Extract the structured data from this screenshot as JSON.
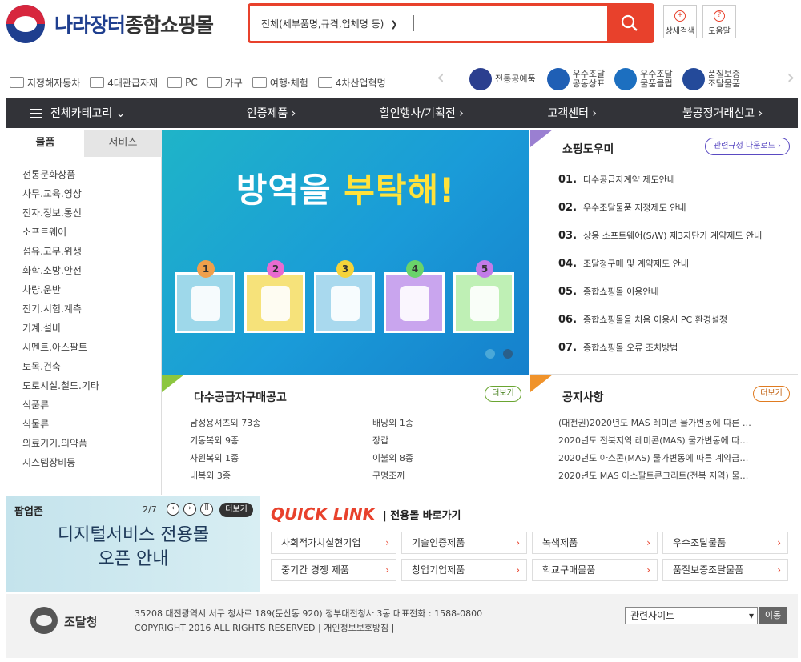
{
  "header": {
    "logo_text_1": "나라장터",
    "logo_text_2": "종합쇼핑몰",
    "search_select": "전체(세부품명,규격,업체명 등)",
    "search_placeholder": "",
    "detail_search": "상세검색",
    "help": "도움말"
  },
  "quick_menu": [
    "지정해자동차",
    "4대관급자재",
    "PC",
    "가구",
    "여행·체험",
    "4차산업혁명"
  ],
  "brands": [
    {
      "label": "전통공예품",
      "color": "#2b3f8f"
    },
    {
      "label": "우수조달\n공동상표",
      "color": "#1f5fb5"
    },
    {
      "label": "우수조달\n물품클럽",
      "color": "#1c6fc0"
    },
    {
      "label": "품질보증\n조달물품",
      "color": "#244a9a"
    }
  ],
  "nav": [
    "전체카테고리",
    "인증제품",
    "할인행사/기획전",
    "고객센터",
    "불공정거래신고"
  ],
  "left_tabs": [
    "물품",
    "서비스"
  ],
  "left_menu": [
    "전통문화상품",
    "사무.교육.영상",
    "전자.정보.통신",
    "소프트웨어",
    "섬유.고무.위생",
    "화학.소방.안전",
    "차량.운반",
    "전기.시험.계측",
    "기계.설비",
    "시멘트.아스팔트",
    "토목.건축",
    "도로시설.철도.기타",
    "식품류",
    "식물류",
    "의료기기.의약품",
    "시스템장비등"
  ],
  "banner": {
    "title_1": "방역을",
    "title_2": "부탁해!",
    "items": [
      {
        "num": "1",
        "color": "#f0a04b"
      },
      {
        "num": "2",
        "color": "#e86bd0"
      },
      {
        "num": "3",
        "color": "#f5d33a"
      },
      {
        "num": "4",
        "color": "#6ad36a"
      },
      {
        "num": "5",
        "color": "#c27be8"
      }
    ]
  },
  "guide": {
    "title": "쇼핑도우미",
    "button": "관련규정 다운로드",
    "items": [
      {
        "num": "01.",
        "text": "다수공급자계약 제도안내"
      },
      {
        "num": "02.",
        "text": "우수조달물품 지정제도 안내"
      },
      {
        "num": "03.",
        "text": "상용 소프트웨어(S/W) 제3자단가 계약제도 안내"
      },
      {
        "num": "04.",
        "text": "조달청구매 및 계약제도 안내"
      },
      {
        "num": "05.",
        "text": "종합쇼핑몰 이용안내"
      },
      {
        "num": "06.",
        "text": "종합쇼핑몰을 처음 이용시 PC 환경설정"
      },
      {
        "num": "07.",
        "text": "종합쇼핑몰 오류 조치방법"
      }
    ]
  },
  "mas": {
    "title": "다수공급자구매공고",
    "more": "더보기",
    "col1": [
      "남성용셔츠외 73종",
      "기동복외 9종",
      "사원복외 1종",
      "내복외 3종"
    ],
    "col2": [
      "배낭외 1종",
      "장갑",
      "이불외 8종",
      "구명조끼"
    ]
  },
  "notice": {
    "title": "공지사항",
    "more": "더보기",
    "items": [
      "(대전권)2020년도 MAS 레미콘 물가변동에 따른 …",
      "2020년도 전북지역 레미콘(MAS) 물가변동에 따…",
      "2020년도 아스콘(MAS) 물가변동에 따른 계약금…",
      "2020년도 MAS 아스팔트콘크리트(전북 지역) 물…"
    ]
  },
  "popup": {
    "title": "팝업존",
    "count": "2/7",
    "more": "더보기",
    "line1": "디지털서비스 전용몰",
    "line2": "오픈 안내"
  },
  "quicklink": {
    "title": "QUICK LINK",
    "subtitle": "| 전용몰 바로가기",
    "items": [
      "사회적가치실현기업",
      "기술인증제품",
      "녹색제품",
      "우수조달물품",
      "중기간 경쟁 제품",
      "창업기업제품",
      "학교구매물품",
      "품질보증조달물품"
    ]
  },
  "footer": {
    "logo": "조달청",
    "address": "35208 대전광역시 서구 청사로 189(둔산동 920) 정부대전청사 3동 대표전화 : 1588-0800",
    "copyright": "COPYRIGHT 2016 ALL RIGHTS RESERVED | 개인정보보호방침 |",
    "select": "관련사이트",
    "go": "이동"
  }
}
